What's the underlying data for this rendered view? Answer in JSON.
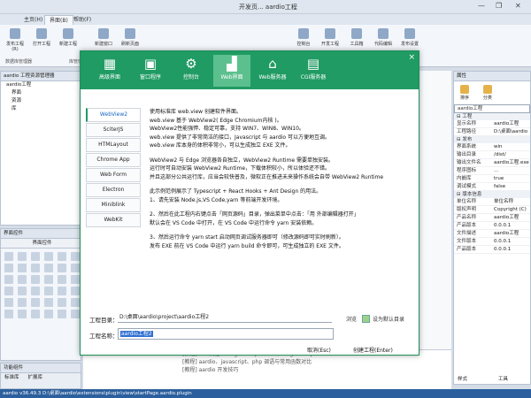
{
  "window": {
    "title": "开发页... aardio工程",
    "minimize": "—",
    "maximize": "❐",
    "close": "✕"
  },
  "ribbon": {
    "tabs": [
      "主页(H)",
      "界面(B)",
      "帮助(F)"
    ],
    "buttons": [
      "发布工程(R)",
      "打开工程",
      "新建工程",
      "新建窗口",
      "刷新页面",
      "控制台",
      "开发工程",
      "工具箱",
      "代码编辑",
      "发布设置"
    ],
    "groups": [
      "数据库管理器",
      "库管理"
    ]
  },
  "left_panel": {
    "title": "aardio 工程资源管理器",
    "items": [
      "aardio工程",
      "界面",
      "资源",
      "库"
    ],
    "toolbox_title": "界面控件",
    "toolbox_sub": "界面控件",
    "bottom_title": "功能组件",
    "bottom_items": [
      "标准库",
      "扩展库"
    ]
  },
  "right_panel": {
    "title": "属性",
    "tabs": [
      "排序",
      "分类"
    ],
    "object": "aardio工程",
    "categories": [
      {
        "name": "工程",
        "rows": [
          [
            "显示名称",
            "aardio工程"
          ],
          [
            "工程路径",
            "D:\\桌面\\aardio"
          ]
        ]
      },
      {
        "name": "发布",
        "rows": [
          [
            "界面系统",
            "win"
          ],
          [
            "输出目录",
            "/dist/"
          ],
          [
            "输出文件名",
            "aardio工程.exe"
          ],
          [
            "程序图标",
            "..."
          ],
          [
            "内嵌库",
            "true"
          ],
          [
            "调试模式",
            "false"
          ]
        ]
      },
      {
        "name": "版本信息",
        "rows": [
          [
            "单位名称",
            "单位名称"
          ],
          [
            "版权声明",
            "Copyright (C)"
          ],
          [
            "产品名称",
            "aardio工程"
          ],
          [
            "产品版本",
            "0.0.0.1"
          ],
          [
            "文件描述",
            "aardio工程"
          ],
          [
            "文件版本",
            "0.0.0.1"
          ],
          [
            "产品版本",
            "0.0.0.1"
          ]
        ]
      }
    ],
    "bottom_tabs": [
      "样式",
      "工具"
    ]
  },
  "output": {
    "lines": [
      "[教程] CSS属性 background-position ,foreground-position",
      "[教程] aardio、javascript、php 调语与常用函数对比",
      "[教程] aardio 开发技巧"
    ]
  },
  "statusbar": {
    "text": "aardio v36.49.3    D:\\桌面\\aardio\\extensions\\plugin\\view\\startPage.aardio.plugin"
  },
  "dialog": {
    "close": "×",
    "top_tabs": [
      {
        "label": "高级界面",
        "icon": "grid-icon",
        "glyph": "▦"
      },
      {
        "label": "窗口程序",
        "icon": "window-icon",
        "glyph": "▣"
      },
      {
        "label": "控制台",
        "icon": "gears-icon",
        "glyph": "⚙"
      },
      {
        "label": "Web界面",
        "icon": "chart-icon",
        "glyph": "▟"
      },
      {
        "label": "Web服务器",
        "icon": "home-icon",
        "glyph": "⌂"
      },
      {
        "label": "CGI服务器",
        "icon": "server-icon",
        "glyph": "▤"
      }
    ],
    "selected_top_tab": 3,
    "side_items": [
      "WebView2",
      "SciterJS",
      "HTMLayout",
      "Chrome App",
      "Web Form",
      "Electron",
      "Miniblink",
      "WebKit"
    ],
    "selected_side": 0,
    "description": [
      [
        "使用标准库 web.view 创建软件界面。",
        "web.view 基于 WebView2( Edge Chromium内核 )。",
        "WebView2性能强悍、稳定可靠，支持 WIN7、WIN8、WIN10。",
        "web.view 提供了非常简洁的接口，Javascript 与 aardio 可以方便地互调。",
        "web.view 库本身的体积非常小，可以生成独立 EXE 文件。"
      ],
      [
        "WebView2 与 Edge 浏览器各自独立，WebView2 Runtime 需要单独安装。",
        "运行时可自动安装 WebView2 Runtime，下载体积较小，所以体验还不错。",
        "并且这部分公共运行库，应当会较快普及，微软正在推进未来操作系统会自带 WebView2 Runtime"
      ],
      [
        "此示例范例展示了 Typescript + React Hooks + Ant Design 的用法。",
        "1、请先安装 Node.js,VS Code,yarn 等前端开发环境。"
      ],
      [
        "2、然后在此工程内右键点击「网页源码」目录，弹出菜单中点击：「用 外部编辑器打开」",
        "默认会在 VS Code 中打开，在 VS Code 中运行命令 yarn 安装依赖。"
      ],
      [
        "3、然后运行命令 yarn start 启动网页调试服务器即可（修改源码即可实时刷新）。",
        "发布 EXE 前在 VS Code 中运行 yarn build 命令即可，可生成独立的 EXE 文件。"
      ]
    ],
    "dir_label": "工程目录：",
    "dir_value": "D:\\桌面\\aardio\\project\\aardio工程2",
    "browse": "浏览",
    "default_dir_label": "设为默认目录",
    "name_label": "工程名称：",
    "name_value": "aardio工程2",
    "cancel": "取消(Esc)",
    "create": "创建工程(Enter)"
  },
  "colors": {
    "dialog_header": "#1f9b63",
    "selected_tab": "#5cc08e",
    "statusbar": "#2b5f9e"
  }
}
